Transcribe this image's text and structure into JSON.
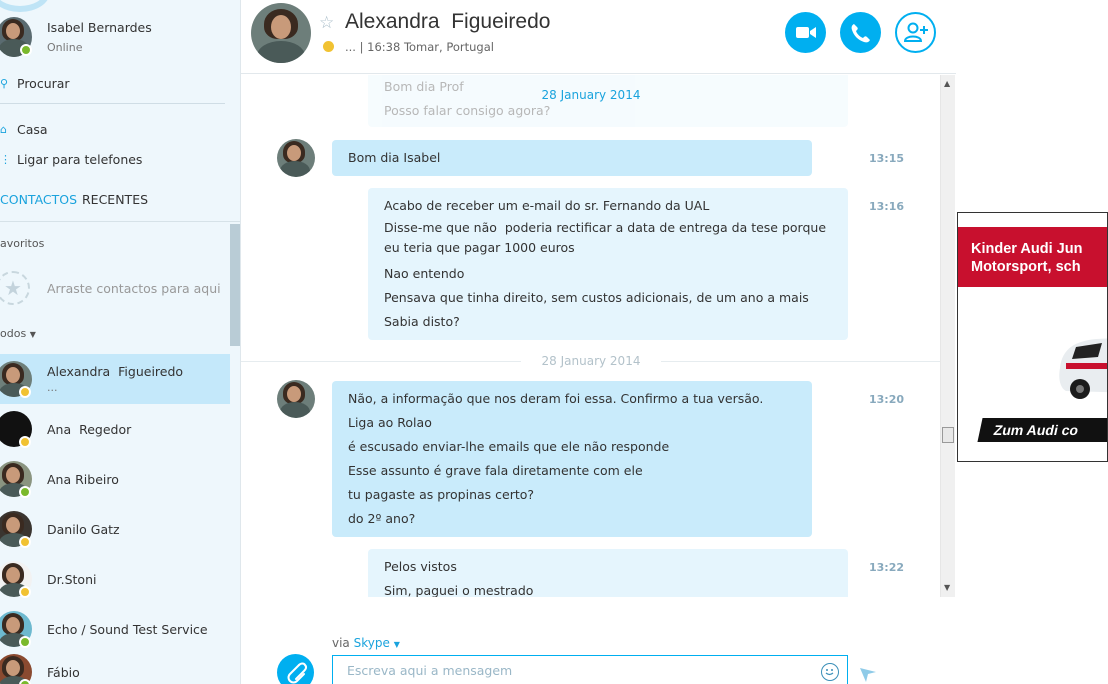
{
  "colors": {
    "accent": "#00aff0",
    "online": "#7ab92c",
    "away": "#f1c232",
    "ad_brand": "#c8102e"
  },
  "me": {
    "name": "Isabel Bernardes",
    "presence": "Online",
    "status": "online"
  },
  "nav": {
    "search_label": "Procurar",
    "home_label": "Casa",
    "phones_label": "Ligar para telefones"
  },
  "tabs": {
    "contacts": "CONTACTOS",
    "recent": "RECENTES"
  },
  "favorites": {
    "header": "avoritos",
    "drop_hint": "Arraste contactos para aqui"
  },
  "all_header": "odos",
  "contacts": [
    {
      "name": "Alexandra  Figueiredo",
      "mood": "...",
      "status": "away",
      "selected": true
    },
    {
      "name": "Ana  Regedor",
      "mood": "",
      "status": "away"
    },
    {
      "name": "Ana Ribeiro",
      "mood": "",
      "status": "online"
    },
    {
      "name": "Danilo Gatz",
      "mood": "",
      "status": "away"
    },
    {
      "name": "Dr.Stoni",
      "mood": "",
      "status": "away"
    },
    {
      "name": "Echo / Sound Test Service",
      "mood": "",
      "status": "online"
    },
    {
      "name": "Fábio",
      "mood": "",
      "status": "online"
    }
  ],
  "conversation": {
    "peer_name": "Alexandra  Figueiredo",
    "peer_subtitle": "... | 16:38 Tomar, Portugal",
    "date_1": "28 January 2014",
    "date_2": "28 January 2014",
    "messages": [
      {
        "dir": "out",
        "time": "",
        "lines": [
          "Bom dia Prof",
          "Posso falar consigo agora?"
        ]
      },
      {
        "dir": "in",
        "time": "13:15",
        "lines": [
          "Bom dia Isabel"
        ]
      },
      {
        "dir": "out",
        "time": "13:16",
        "lines": [
          "Acabo de receber um e-mail do sr. Fernando da UAL",
          "Disse-me que não  poderia rectificar a data de entrega da tese porque",
          "eu teria que pagar 1000 euros",
          "Nao entendo",
          "Pensava que tinha direito, sem custos adicionais, de um ano a mais",
          "Sabia disto?"
        ]
      },
      {
        "dir": "in",
        "time": "13:20",
        "lines": [
          "Não, a informação que nos deram foi essa. Confirmo a tua versão.",
          "Liga ao Rolao",
          "é escusado enviar-lhe emails que ele não responde",
          "Esse assunto é grave fala diretamente com ele",
          "tu pagaste as propinas certo?",
          "do 2º ano?"
        ]
      },
      {
        "dir": "out",
        "time": "13:22",
        "lines": [
          "Pelos vistos",
          "Sim, paguei o mestrado"
        ]
      }
    ]
  },
  "compose": {
    "via_prefix": "via ",
    "via_service": "Skype",
    "placeholder": "Escreva aqui a mensagem"
  },
  "ad": {
    "headline_1": "Kinder Audi Jun",
    "headline_2": "Motorsport, sch",
    "cta": "Zum Audi co"
  }
}
